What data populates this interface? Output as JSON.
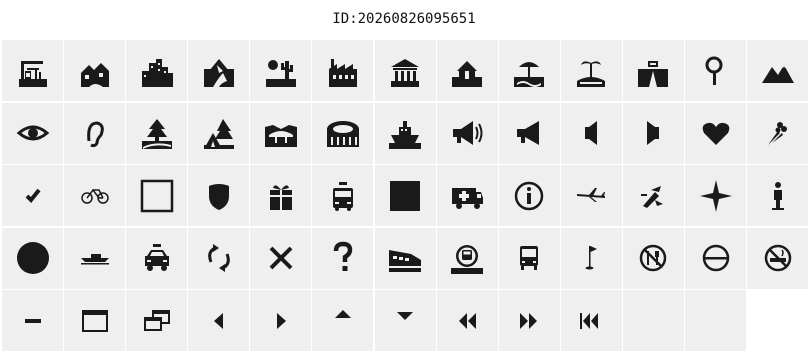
{
  "header": {
    "id_text": "ID:20260826095651"
  },
  "colors": {
    "ink": "#1a1a1a",
    "cell_bg": "#efefef",
    "page_bg": "#ffffff"
  },
  "icons": [
    "construction-site-icon",
    "houses-village-icon",
    "city-skyline-icon",
    "damaged-house-icon",
    "desert-cactus-icon",
    "factory-icon",
    "bank-building-icon",
    "house-scene-icon",
    "beach-umbrella-icon",
    "island-palm-icon",
    "road-vehicle-icon",
    "magnifier-icon",
    "mountains-icon",
    "eye-icon",
    "ear-icon",
    "forest-river-icon",
    "tent-camping-icon",
    "bridge-scene-icon",
    "stadium-icon",
    "ship-scene-icon",
    "megaphone-loud-icon",
    "megaphone-icon",
    "speaker-right-icon",
    "speaker-left-icon",
    "heart-icon",
    "bouquet-icon",
    "check-mark-icon",
    "bicycle-icon",
    "empty-square-icon",
    "shield-icon",
    "gift-box-icon",
    "fire-truck-icon",
    "filled-square-icon",
    "ambulance-icon",
    "information-icon",
    "airplane-icon",
    "broken-plane-icon",
    "compass-star-icon",
    "man-standing-icon",
    "filled-circle-icon",
    "boat-icon",
    "police-car-icon",
    "refresh-arrows-icon",
    "close-x-icon",
    "question-mark-icon",
    "train-scene-icon",
    "bus-sign-icon",
    "bus-front-icon",
    "golf-flag-icon",
    "no-eating-icon",
    "no-entry-icon",
    "no-smoking-icon",
    "minus-icon",
    "window-icon",
    "windows-restore-icon",
    "triangle-left-icon",
    "triangle-right-icon",
    "triangle-up-icon",
    "triangle-down-icon",
    "rewind-icon",
    "fast-forward-icon",
    "skip-back-icon"
  ]
}
